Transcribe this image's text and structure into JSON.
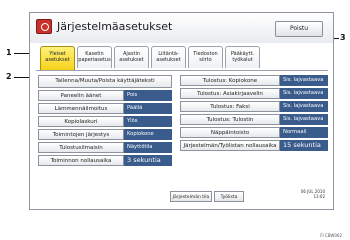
{
  "window": {
    "title": "Järjestelmäasetukset",
    "exit_label": "Poistu"
  },
  "tabs": [
    {
      "line1": "Yleiset",
      "line2": "asetukset",
      "active": true
    },
    {
      "line1": "Kasetin",
      "line2": "paperiasetus",
      "active": false
    },
    {
      "line1": "Ajastin",
      "line2": "asetukset",
      "active": false
    },
    {
      "line1": "Liitäntä-",
      "line2": "asetukset",
      "active": false
    },
    {
      "line1": "Tiedoston",
      "line2": "siirto",
      "active": false
    },
    {
      "line1": "Pääkäytt.",
      "line2": "työkalut",
      "active": false
    }
  ],
  "left_top_button": "Tallenna/Muuta/Poista käyttäjäteksti",
  "left_rows": [
    {
      "label": "Paneelin äänet",
      "value": "Pois"
    },
    {
      "label": "Lämmennäilmoitus",
      "value": "Päällä"
    },
    {
      "label": "Kopiolaskuri",
      "value": "Ylös"
    },
    {
      "label": "Toimintojen järjestys",
      "value": "Kopiokone"
    },
    {
      "label": "Tulostusilmaisin",
      "value": "Näyttötila"
    },
    {
      "label": "Toiminnon nollausaika",
      "value": "3 sekuntia"
    }
  ],
  "right_rows": [
    {
      "label": "Tulostus: Kopiokone",
      "value": "Sis. lajvastaava 1"
    },
    {
      "label": "Tulostus: Asiakirjaavelin",
      "value": "Sis. lajvastaava 1"
    },
    {
      "label": "Tulostus: Faksi",
      "value": "Sis. lajvastaava 2"
    },
    {
      "label": "Tulostus: Tulostin",
      "value": "Sis. lajvastaava 1"
    },
    {
      "label": "Näppäintoisto",
      "value": "Normaali"
    },
    {
      "label": "Järjestelmän/Työlistan nollausaika",
      "value": "15 sekuntia"
    }
  ],
  "bottom": {
    "system_status": "Järjestelmän tila",
    "joblist": "Työlista",
    "date": "06 JUL 2010",
    "time": "13:02"
  },
  "callouts": {
    "one": "1",
    "two": "2",
    "three": "3"
  },
  "figure_id": "FI CBW002"
}
